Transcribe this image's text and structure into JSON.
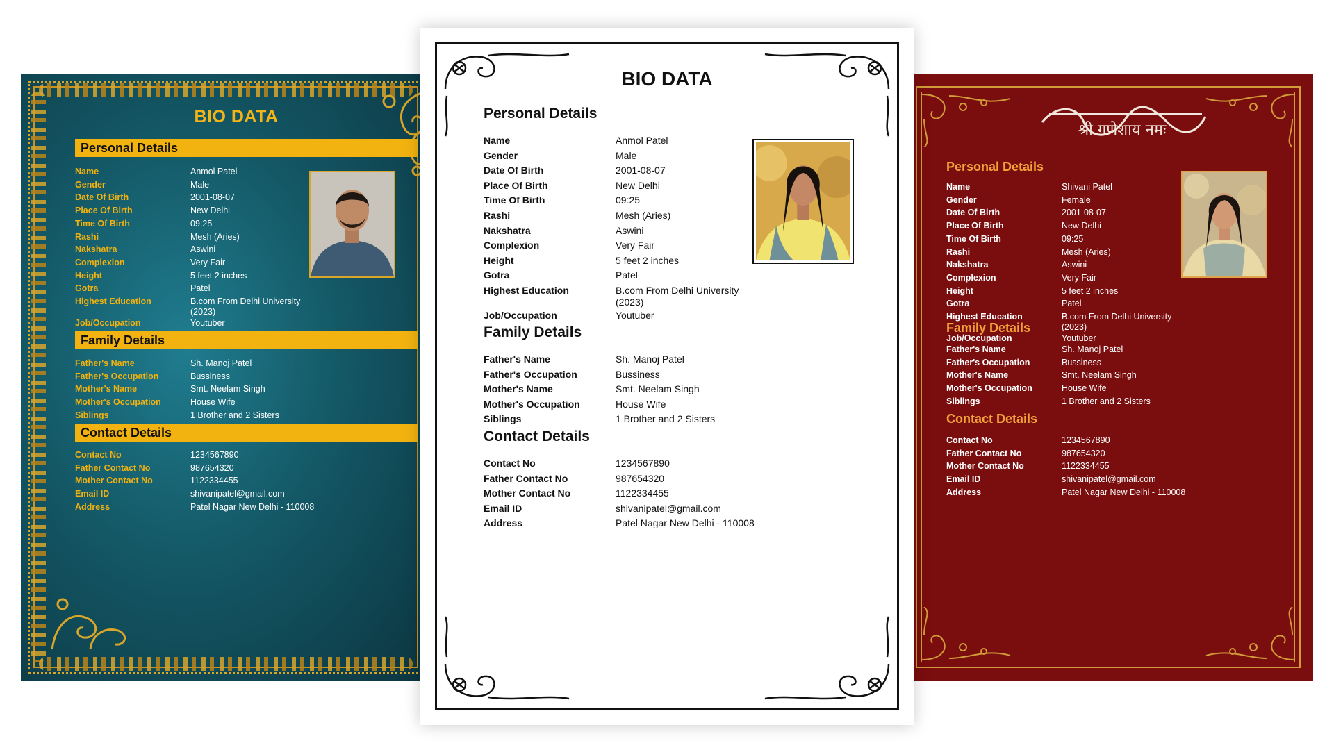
{
  "left_card": {
    "title": "BIO DATA",
    "sections": {
      "personal": "Personal Details",
      "family": "Family Details",
      "contact": "Contact Details"
    },
    "personal": [
      {
        "label": "Name",
        "value": "Anmol Patel"
      },
      {
        "label": "Gender",
        "value": "Male"
      },
      {
        "label": "Date Of Birth",
        "value": "2001-08-07"
      },
      {
        "label": "Place Of Birth",
        "value": "New Delhi"
      },
      {
        "label": "Time Of Birth",
        "value": "09:25"
      },
      {
        "label": "Rashi",
        "value": "Mesh (Aries)"
      },
      {
        "label": "Nakshatra",
        "value": "Aswini"
      },
      {
        "label": "Complexion",
        "value": "Very Fair"
      },
      {
        "label": "Height",
        "value": "5 feet 2 inches"
      },
      {
        "label": "Gotra",
        "value": "Patel"
      },
      {
        "label": "Highest Education",
        "value": "B.com From Delhi University (2023)"
      },
      {
        "label": "Job/Occupation",
        "value": "Youtuber"
      }
    ],
    "family": [
      {
        "label": "Father's Name",
        "value": "Sh. Manoj Patel"
      },
      {
        "label": "Father's Occupation",
        "value": "Bussiness"
      },
      {
        "label": "Mother's Name",
        "value": "Smt. Neelam Singh"
      },
      {
        "label": "Mother's Occupation",
        "value": "House Wife"
      },
      {
        "label": "Siblings",
        "value": "1 Brother and 2 Sisters"
      }
    ],
    "contact": [
      {
        "label": "Contact No",
        "value": "1234567890"
      },
      {
        "label": "Father Contact No",
        "value": "987654320"
      },
      {
        "label": "Mother Contact No",
        "value": "1122334455"
      },
      {
        "label": "Email ID",
        "value": "shivanipatel@gmail.com"
      },
      {
        "label": "Address",
        "value": "Patel Nagar New Delhi - 110008"
      }
    ]
  },
  "center_card": {
    "title": "BIO DATA",
    "sections": {
      "personal": "Personal Details",
      "family": "Family Details",
      "contact": "Contact Details"
    },
    "personal": [
      {
        "label": "Name",
        "value": "Anmol Patel"
      },
      {
        "label": "Gender",
        "value": "Male"
      },
      {
        "label": "Date Of Birth",
        "value": "2001-08-07"
      },
      {
        "label": "Place Of Birth",
        "value": "New Delhi"
      },
      {
        "label": "Time Of Birth",
        "value": "09:25"
      },
      {
        "label": "Rashi",
        "value": "Mesh (Aries)"
      },
      {
        "label": "Nakshatra",
        "value": "Aswini"
      },
      {
        "label": "Complexion",
        "value": "Very Fair"
      },
      {
        "label": "Height",
        "value": "5 feet 2 inches"
      },
      {
        "label": "Gotra",
        "value": "Patel"
      },
      {
        "label": "Highest Education",
        "value": "B.com From Delhi University (2023)"
      },
      {
        "label": "Job/Occupation",
        "value": "Youtuber"
      }
    ],
    "family": [
      {
        "label": "Father's Name",
        "value": "Sh. Manoj Patel"
      },
      {
        "label": "Father's Occupation",
        "value": "Bussiness"
      },
      {
        "label": "Mother's Name",
        "value": "Smt. Neelam Singh"
      },
      {
        "label": "Mother's Occupation",
        "value": "House Wife"
      },
      {
        "label": "Siblings",
        "value": "1 Brother and 2 Sisters"
      }
    ],
    "contact": [
      {
        "label": "Contact No",
        "value": "1234567890"
      },
      {
        "label": "Father Contact No",
        "value": "987654320"
      },
      {
        "label": "Mother Contact No",
        "value": "1122334455"
      },
      {
        "label": "Email ID",
        "value": "shivanipatel@gmail.com"
      },
      {
        "label": "Address",
        "value": "Patel Nagar New Delhi - 110008"
      }
    ]
  },
  "right_card": {
    "header_shlok": "श्री गणेशाय नमः",
    "sections": {
      "personal": "Personal Details",
      "family": "Family Details",
      "contact": "Contact Details"
    },
    "personal": [
      {
        "label": "Name",
        "value": "Shivani Patel"
      },
      {
        "label": "Gender",
        "value": "Female"
      },
      {
        "label": "Date Of Birth",
        "value": "2001-08-07"
      },
      {
        "label": "Place Of Birth",
        "value": "New Delhi"
      },
      {
        "label": "Time Of Birth",
        "value": "09:25"
      },
      {
        "label": "Rashi",
        "value": "Mesh (Aries)"
      },
      {
        "label": "Nakshatra",
        "value": "Aswini"
      },
      {
        "label": "Complexion",
        "value": "Very Fair"
      },
      {
        "label": "Height",
        "value": "5 feet 2 inches"
      },
      {
        "label": "Gotra",
        "value": "Patel"
      },
      {
        "label": "Highest Education",
        "value": "B.com From Delhi University (2023)"
      },
      {
        "label": "Job/Occupation",
        "value": "Youtuber"
      }
    ],
    "family": [
      {
        "label": "Father's Name",
        "value": "Sh. Manoj Patel"
      },
      {
        "label": "Father's Occupation",
        "value": "Bussiness"
      },
      {
        "label": "Mother's Name",
        "value": "Smt. Neelam Singh"
      },
      {
        "label": "Mother's Occupation",
        "value": "House Wife"
      },
      {
        "label": "Siblings",
        "value": "1 Brother and 2 Sisters"
      }
    ],
    "contact": [
      {
        "label": "Contact No",
        "value": "1234567890"
      },
      {
        "label": "Father Contact No",
        "value": "987654320"
      },
      {
        "label": "Mother Contact No",
        "value": "1122334455"
      },
      {
        "label": "Email ID",
        "value": "shivanipatel@gmail.com"
      },
      {
        "label": "Address",
        "value": "Patel Nagar New Delhi - 110008"
      }
    ]
  },
  "colors": {
    "teal_bg": "#145866",
    "gold": "#f2b210",
    "maroon_bg": "#7a0d0e",
    "maroon_accent": "#f2a33a",
    "ink": "#111111"
  },
  "icons": [
    "vine-border-ornament",
    "corner-flourish-ornament",
    "male-portrait-photo",
    "female-portrait-photo"
  ]
}
